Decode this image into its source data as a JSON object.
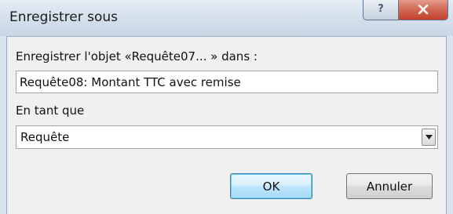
{
  "window": {
    "title": "Enregistrer sous",
    "help_label": "?",
    "close_label": "X"
  },
  "form": {
    "save_object_label": "Enregistrer l'objet «Requête07... » dans :",
    "name_value": "Requête08: Montant TTC avec remise",
    "as_label": "En tant que",
    "type_value": "Requête"
  },
  "buttons": {
    "ok_label": "OK",
    "cancel_label": "Annuler"
  },
  "colors": {
    "close_button": "#c3402a",
    "default_button_border": "#3c7fb1",
    "dialog_background": "#f0f0f0"
  },
  "icons": {
    "help": "help-icon",
    "close": "close-icon",
    "dropdown": "chevron-down-icon"
  }
}
